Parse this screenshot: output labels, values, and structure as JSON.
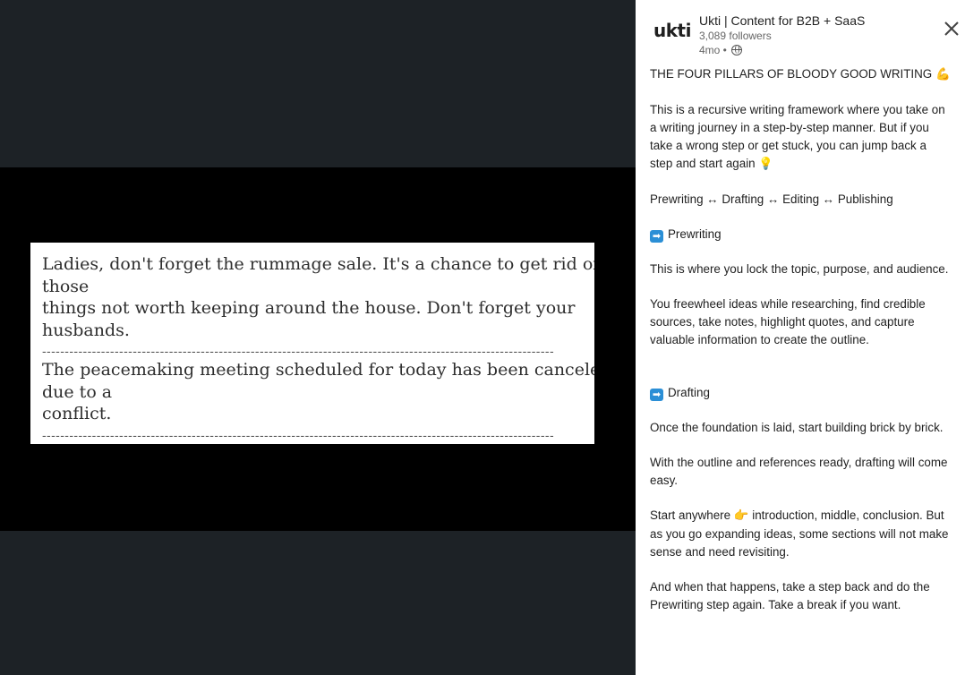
{
  "media": {
    "lines": [
      "Ladies, don't forget the rummage sale. It's a chance to get rid of",
      "those",
      "things not worth keeping around the house. Don't forget your",
      "husbands."
    ],
    "lines2": [
      "The peacemaking meeting scheduled for today has been canceled",
      "due to a",
      "conflict."
    ],
    "dashes": "-----------------------------------------------------------------------------------------------------------------"
  },
  "author": {
    "logo_text": "ukti",
    "name": "Ukti | Content for B2B + SaaS",
    "followers": "3,089 followers",
    "time": "4mo •"
  },
  "icons": {
    "close": "close-icon",
    "globe": "globe-icon",
    "arrow": "arrow-right-icon"
  },
  "post": {
    "title": "THE FOUR PILLARS OF BLOODY GOOD WRITING",
    "title_emoji": "💪",
    "intro": "This is a recursive writing framework where you take on a writing journey in a step-by-step manner. But if you take a wrong step or get stuck, you can jump back a step and start again",
    "intro_emoji": "💡",
    "flow": "Prewriting ↔ Drafting ↔ Editing ↔ Publishing",
    "section1_heading": "Prewriting",
    "section1_p1": "This is where you lock the topic, purpose, and audience.",
    "section1_p2": "You freewheel ideas while researching, find credible sources, take notes, highlight quotes, and capture valuable information to create the outline.",
    "section2_heading": "Drafting",
    "section2_p1": "Once the foundation is laid, start building brick by brick.",
    "section2_p2": "With the outline and references ready, drafting will come easy.",
    "section2_p3_a": "Start anywhere",
    "section2_p3_emoji": "👉",
    "section2_p3_b": "introduction, middle, conclusion. But as you go expanding ideas, some sections will not make sense and need revisiting.",
    "section2_p4": "And when that happens, take a step back and do the Prewriting step again. Take a break if you want."
  },
  "colors": {
    "backdrop": "#1d2226",
    "media_band": "#000000",
    "badge": "#2b8fd6"
  }
}
